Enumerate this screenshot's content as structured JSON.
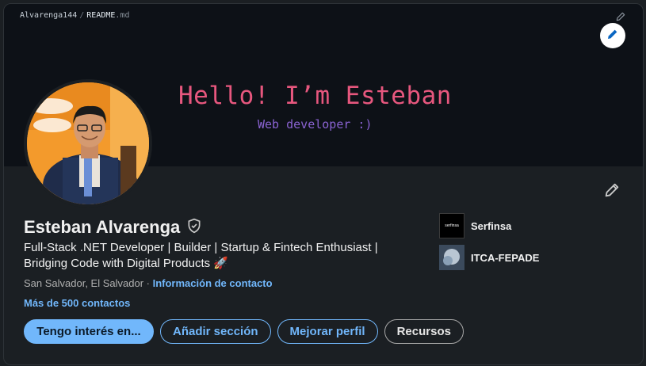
{
  "readme": {
    "user": "Alvarenga144",
    "separator": "/",
    "file": "README",
    "ext": ".md",
    "hello": "Hello! I’m Esteban",
    "subtitle": "Web developer :)"
  },
  "profile": {
    "name": "Esteban Alvarenga",
    "headline": "Full-Stack .NET Developer | Builder | Startup & Fintech Enthusiast | Bridging Code with Digital Products 🚀",
    "location": "San Salvador, El Salvador",
    "location_sep": " · ",
    "contact_link": "Información de contacto",
    "connections": "Más de 500 contactos"
  },
  "buttons": {
    "open_to": "Tengo interés en...",
    "add_section": "Añadir sección",
    "enhance": "Mejorar perfil",
    "resources": "Recursos"
  },
  "orgs": [
    {
      "name": "Serfinsa",
      "logo_text": "serfinsa"
    },
    {
      "name": "ITCA-FEPADE"
    }
  ],
  "icons": {
    "verified": "shield-check-icon",
    "edit_banner": "pencil-icon",
    "edit_profile": "pencil-icon"
  },
  "colors": {
    "accent": "#71b7fb",
    "hello_pink": "#e7577e",
    "subtitle_purple": "#8a63d2"
  }
}
